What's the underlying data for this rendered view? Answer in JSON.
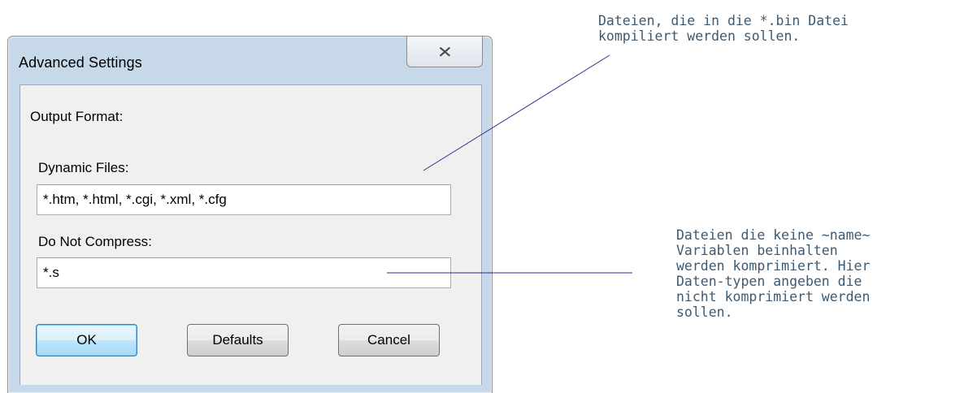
{
  "dialog": {
    "title": "Advanced Settings",
    "close_icon": "✕",
    "output_format_label": "Output Format:",
    "dynamic_files": {
      "label": "Dynamic Files:",
      "value": "*.htm, *.html, *.cgi, *.xml, *.cfg"
    },
    "do_not_compress": {
      "label": "Do Not Compress:",
      "value": "*.s"
    },
    "buttons": {
      "ok": "OK",
      "defaults": "Defaults",
      "cancel": "Cancel"
    }
  },
  "annotations": {
    "dynamic_files_note": "Dateien, die in die *.bin Datei\nkompiliert werden sollen.",
    "compress_note": "Dateien die keine ~name~\nVariablen beinhalten\nwerden komprimiert. Hier\nDaten-typen angeben die\nnicht komprimiert werden\nsollen."
  },
  "colors": {
    "annotation_line": "#2b2b8f",
    "annotation_text": "#3d5a73",
    "frame": "#c7d8e9",
    "client_bg": "#f0f0f0"
  },
  "icons": {
    "close": "close-icon"
  }
}
